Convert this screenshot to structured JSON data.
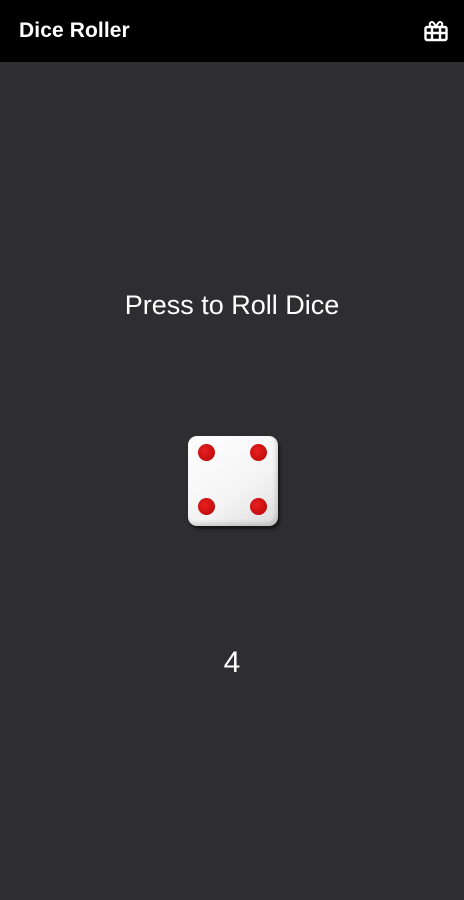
{
  "app": {
    "title": "Dice Roller",
    "action_icon": "gift-card-icon"
  },
  "main": {
    "prompt": "Press to Roll Dice",
    "die": {
      "face": 4,
      "pip_color": "#d01010",
      "face_color": "#f5f5f5"
    },
    "result": "4"
  },
  "colors": {
    "appbar_bg": "#000000",
    "background": "#2e2e30",
    "text": "#ffffff"
  }
}
